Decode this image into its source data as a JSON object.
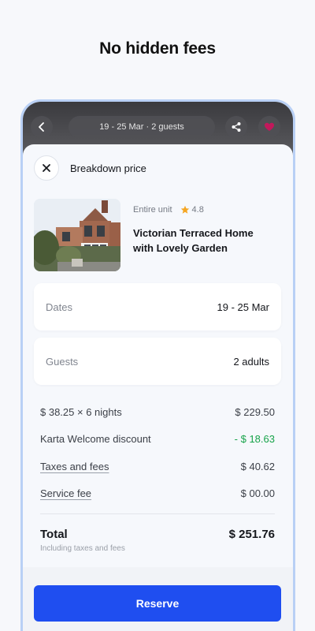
{
  "headline": "No hidden fees",
  "top_bar": {
    "dates_guests": "19 - 25 Mar · 2 guests",
    "back_icon": "chevron-left-icon",
    "share_icon": "share-icon",
    "favorite_icon": "heart-icon",
    "favorite_color": "#c2185b"
  },
  "sheet": {
    "title": "Breakdown price",
    "close_icon": "close-icon"
  },
  "listing": {
    "type": "Entire unit",
    "rating": "4.8",
    "rating_color": "#f5a623",
    "name": "Victorian Terraced Home with Lovely Garden"
  },
  "dates": {
    "label": "Dates",
    "value": "19 - 25 Mar"
  },
  "guests": {
    "label": "Guests",
    "value": "2 adults"
  },
  "breakdown": [
    {
      "label": "$ 38.25 × 6 nights",
      "value": "$ 229.50"
    },
    {
      "label": "Karta Welcome discount",
      "value": "- $ 18.63"
    },
    {
      "label": "Taxes and fees",
      "value": "$ 40.62"
    },
    {
      "label": "Service fee",
      "value": "$ 00.00"
    }
  ],
  "total": {
    "label": "Total",
    "value": "$ 251.76",
    "note": "Including taxes and fees"
  },
  "reserve_label": "Reserve",
  "accent_color": "#1f4ef0",
  "discount_color": "#17a34a"
}
